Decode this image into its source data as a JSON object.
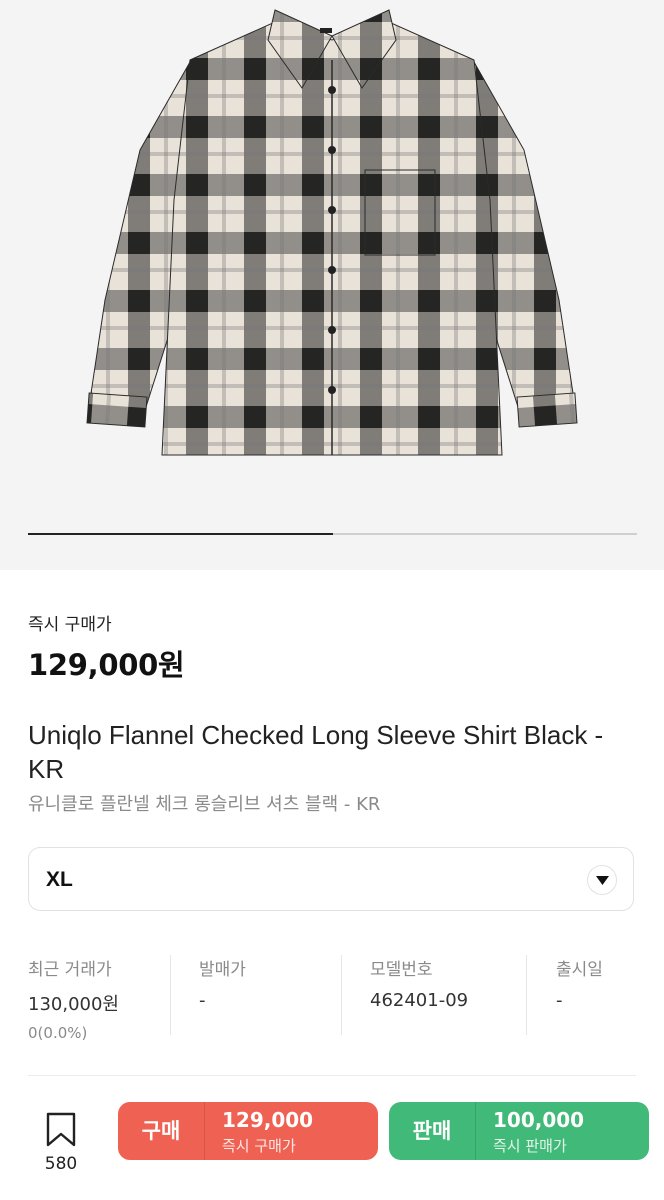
{
  "gallery": {
    "image_alt": "Uniqlo Flannel Checked Long Sleeve Shirt Black",
    "progress": 0.5
  },
  "price": {
    "label": "즉시 구매가",
    "value": "129,000원"
  },
  "product": {
    "name_en": "Uniqlo Flannel Checked Long Sleeve Shirt Black - KR",
    "name_ko": "유니클로 플란넬 체크 롱슬리브 셔츠 블랙 - KR"
  },
  "size": {
    "selected": "XL",
    "icon": "chevron-down-icon"
  },
  "stats": [
    {
      "label": "최근 거래가",
      "value": "130,000원",
      "sub": "0(0.0%)"
    },
    {
      "label": "발매가",
      "value": "-"
    },
    {
      "label": "모델번호",
      "value": "462401-09"
    },
    {
      "label": "출시일",
      "value": "-"
    }
  ],
  "bottom_bar": {
    "bookmark_icon": "bookmark-icon",
    "bookmark_count": "580",
    "buy": {
      "label": "구매",
      "price": "129,000",
      "sub": "즉시 구매가",
      "color": "#ef6253"
    },
    "sell": {
      "label": "판매",
      "price": "100,000",
      "sub": "즉시 판매가",
      "color": "#41b979"
    }
  }
}
